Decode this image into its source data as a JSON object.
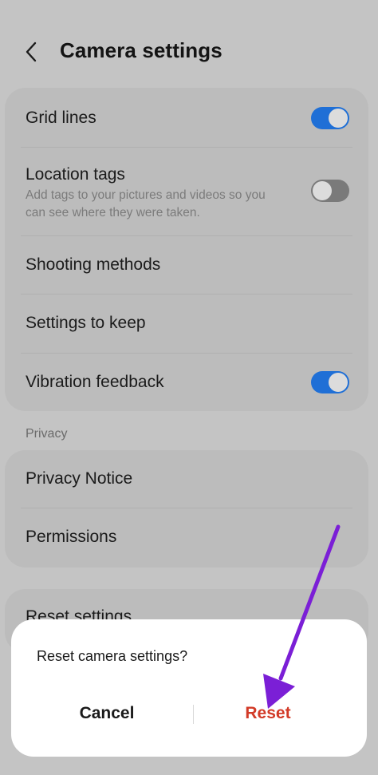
{
  "header": {
    "title": "Camera settings",
    "back_icon": "chevron-left-icon"
  },
  "settings": {
    "grid_lines": {
      "label": "Grid lines",
      "enabled": true
    },
    "location_tags": {
      "label": "Location tags",
      "description": "Add tags to your pictures and videos so you can see where they were taken.",
      "enabled": false
    },
    "shooting_methods": {
      "label": "Shooting methods"
    },
    "settings_to_keep": {
      "label": "Settings to keep"
    },
    "vibration_feedback": {
      "label": "Vibration feedback",
      "enabled": true
    }
  },
  "privacy": {
    "section_label": "Privacy",
    "privacy_notice": "Privacy Notice",
    "permissions": "Permissions"
  },
  "reset": {
    "label": "Reset settings"
  },
  "dialog": {
    "message": "Reset camera settings?",
    "cancel_label": "Cancel",
    "reset_label": "Reset"
  },
  "colors": {
    "toggle_on": "#1f6fd6",
    "reset_text": "#d23a27",
    "annotation_arrow": "#7b1fd6"
  }
}
